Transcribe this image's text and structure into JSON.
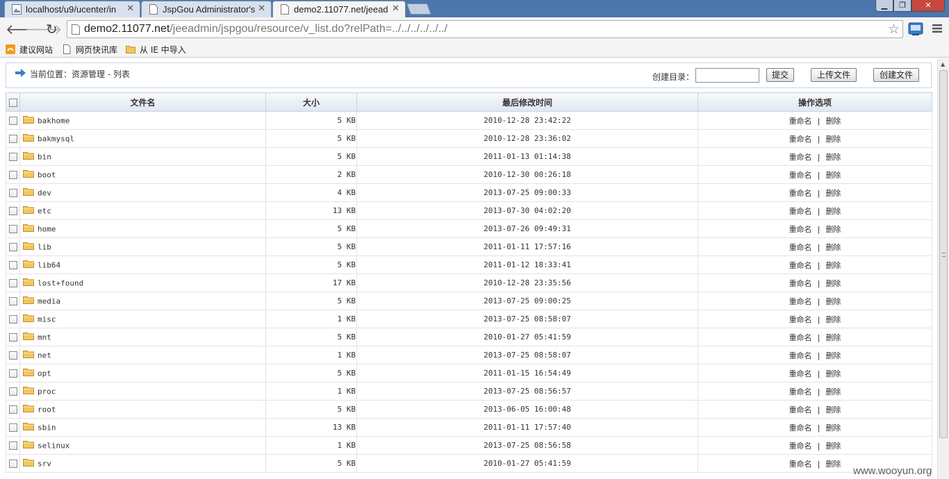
{
  "browser": {
    "tabs": [
      {
        "title": "localhost/u9/ucenter/in",
        "active": false
      },
      {
        "title": "JspGou Administrator's",
        "active": false
      },
      {
        "title": "demo2.11077.net/jeead",
        "active": true
      }
    ],
    "url_host": "demo2.11077.net",
    "url_path": "/jeeadmin/jspgou/resource/v_list.do?relPath=../../../../../../",
    "bookmarks": [
      "建议网站",
      "网页快讯库",
      "从 IE 中导入"
    ]
  },
  "page": {
    "location": "当前位置：资源管理 - 列表",
    "make_dir_label": "创建目录：",
    "make_dir_value": "",
    "submit_label": "提交",
    "upload_label": "上传文件",
    "create_file_label": "创建文件",
    "columns": {
      "name": "文件名",
      "size": "大小",
      "modified": "最后修改时间",
      "ops": "操作选项"
    },
    "rename_label": "重命名",
    "ops_sep": "|",
    "delete_label": "删除",
    "rows": [
      {
        "name": "bakhome",
        "size": "5 KB",
        "modified": "2010-12-28 23:42:22"
      },
      {
        "name": "bakmysql",
        "size": "5 KB",
        "modified": "2010-12-28 23:36:02"
      },
      {
        "name": "bin",
        "size": "5 KB",
        "modified": "2011-01-13 01:14:38"
      },
      {
        "name": "boot",
        "size": "2 KB",
        "modified": "2010-12-30 00:26:18"
      },
      {
        "name": "dev",
        "size": "4 KB",
        "modified": "2013-07-25 09:00:33"
      },
      {
        "name": "etc",
        "size": "13 KB",
        "modified": "2013-07-30 04:02:20"
      },
      {
        "name": "home",
        "size": "5 KB",
        "modified": "2013-07-26 09:49:31"
      },
      {
        "name": "lib",
        "size": "5 KB",
        "modified": "2011-01-11 17:57:16"
      },
      {
        "name": "lib64",
        "size": "5 KB",
        "modified": "2011-01-12 18:33:41"
      },
      {
        "name": "lost+found",
        "size": "17 KB",
        "modified": "2010-12-28 23:35:56"
      },
      {
        "name": "media",
        "size": "5 KB",
        "modified": "2013-07-25 09:00:25"
      },
      {
        "name": "misc",
        "size": "1 KB",
        "modified": "2013-07-25 08:58:07"
      },
      {
        "name": "mnt",
        "size": "5 KB",
        "modified": "2010-01-27 05:41:59"
      },
      {
        "name": "net",
        "size": "1 KB",
        "modified": "2013-07-25 08:58:07"
      },
      {
        "name": "opt",
        "size": "5 KB",
        "modified": "2011-01-15 16:54:49"
      },
      {
        "name": "proc",
        "size": "1 KB",
        "modified": "2013-07-25 08:56:57"
      },
      {
        "name": "root",
        "size": "5 KB",
        "modified": "2013-06-05 16:00:48"
      },
      {
        "name": "sbin",
        "size": "13 KB",
        "modified": "2011-01-11 17:57:40"
      },
      {
        "name": "selinux",
        "size": "1 KB",
        "modified": "2013-07-25 08:56:58"
      },
      {
        "name": "srv",
        "size": "5 KB",
        "modified": "2010-01-27 05:41:59"
      }
    ]
  },
  "watermark": "www.wooyun.org",
  "colors": {
    "tabstrip": "#4d76ad",
    "header_gradient_top": "#f7f9fb",
    "header_gradient_bottom": "#dfe7f0",
    "close_button": "#c9483e",
    "folder_yellow": "#f2c75c"
  }
}
